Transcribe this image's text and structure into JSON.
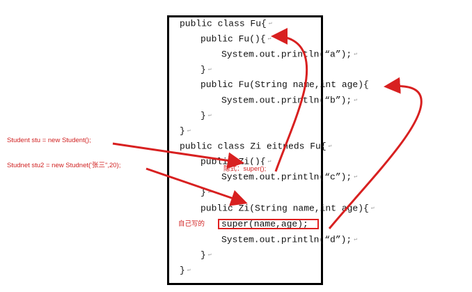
{
  "code": {
    "line1": "public class Fu{",
    "line2": "public Fu(){",
    "line3": "System.out.println(“a”);",
    "line4": "}",
    "line5": "public Fu(String name,int age){",
    "line6": "System.out.println(“b”);",
    "line7": "}",
    "line8": "}",
    "line9": "public class Zi eitneds Fu{",
    "line10": "public Zi(){",
    "line11": "System.out.println(“c”);",
    "line12": "}",
    "line13": "public Zi(String name,int age){",
    "line14": "super(name,age);",
    "line15": "System.out.println(“d”);",
    "line16": "}",
    "line17": "}",
    "paragraph_mark": "↵"
  },
  "annotations": {
    "student_call_1": "Student stu = new Student();",
    "student_call_2": "Studnet stu2 = new Studnet('张三\",20);",
    "implicit_super": "隐式：super();",
    "self_written": "自己写的"
  },
  "colors": {
    "annotation": "#d02020",
    "border": "#000000",
    "paragraph_mark": "#9a9a9a"
  }
}
